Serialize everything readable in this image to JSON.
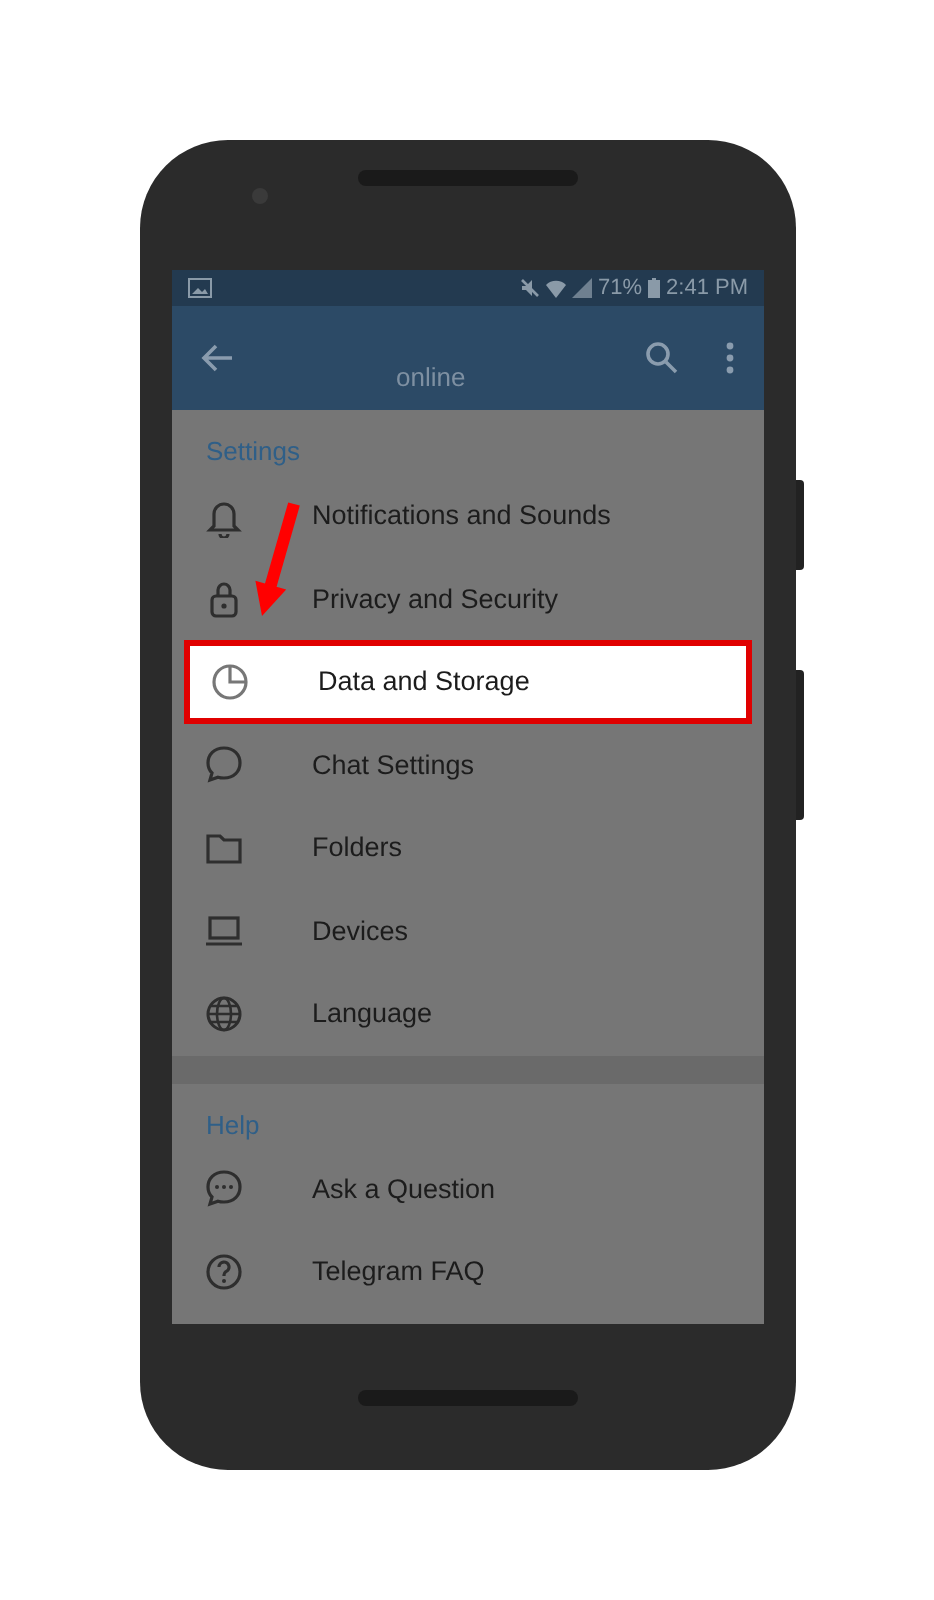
{
  "status_bar": {
    "battery": "71%",
    "time": "2:41 PM"
  },
  "app_bar": {
    "subtitle": "online"
  },
  "sections": [
    {
      "title": "Settings",
      "items": [
        {
          "label": "Notifications and Sounds",
          "selected": false
        },
        {
          "label": "Privacy and Security",
          "selected": false
        },
        {
          "label": "Data and Storage",
          "selected": true
        },
        {
          "label": "Chat Settings",
          "selected": false
        },
        {
          "label": "Folders",
          "selected": false
        },
        {
          "label": "Devices",
          "selected": false
        },
        {
          "label": "Language",
          "selected": false
        }
      ]
    },
    {
      "title": "Help",
      "items": [
        {
          "label": "Ask a Question",
          "selected": false
        },
        {
          "label": "Telegram FAQ",
          "selected": false
        }
      ]
    }
  ]
}
